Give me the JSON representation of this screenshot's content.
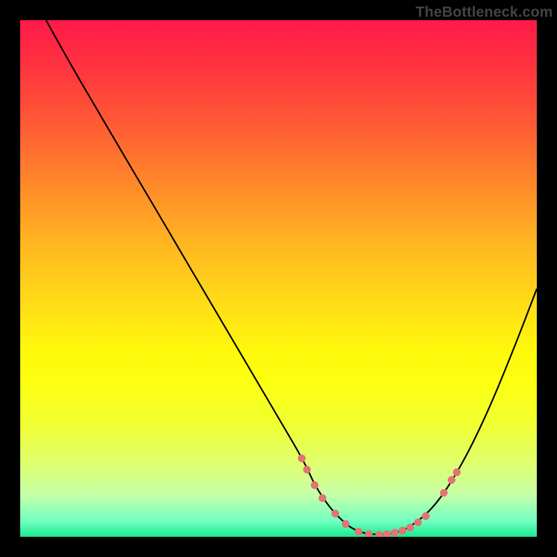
{
  "watermark": "TheBottleneck.com",
  "chart_data": {
    "type": "line",
    "title": "",
    "xlabel": "",
    "ylabel": "",
    "xlim": [
      0,
      100
    ],
    "ylim": [
      0,
      100
    ],
    "grid": false,
    "legend": false,
    "series": [
      {
        "name": "bottleneck-curve",
        "color": "#000000",
        "x": [
          5,
          10,
          15,
          20,
          25,
          30,
          35,
          40,
          45,
          50,
          55,
          57,
          60,
          63,
          65,
          67,
          70,
          72,
          75,
          80,
          85,
          90,
          95,
          100
        ],
        "y": [
          100,
          91,
          82.5,
          74,
          65.5,
          57,
          48.5,
          40,
          31.5,
          23,
          14.5,
          10,
          5.5,
          2.5,
          1.2,
          0.6,
          0.4,
          0.6,
          1.5,
          5.5,
          13,
          23,
          35,
          48
        ]
      }
    ],
    "markers": {
      "name": "highlight-dots",
      "color": "#e57373",
      "radius": 5.5,
      "points": [
        {
          "x": 54.5,
          "y": 15.2
        },
        {
          "x": 55.5,
          "y": 13.0
        },
        {
          "x": 57.0,
          "y": 10.0
        },
        {
          "x": 58.5,
          "y": 7.5
        },
        {
          "x": 61.0,
          "y": 4.5
        },
        {
          "x": 63.0,
          "y": 2.5
        },
        {
          "x": 65.5,
          "y": 1.0
        },
        {
          "x": 67.5,
          "y": 0.5
        },
        {
          "x": 69.5,
          "y": 0.4
        },
        {
          "x": 71.0,
          "y": 0.5
        },
        {
          "x": 72.5,
          "y": 0.8
        },
        {
          "x": 74.0,
          "y": 1.2
        },
        {
          "x": 75.5,
          "y": 1.8
        },
        {
          "x": 77.0,
          "y": 2.8
        },
        {
          "x": 78.5,
          "y": 4.0
        },
        {
          "x": 82.0,
          "y": 8.5
        },
        {
          "x": 83.5,
          "y": 11.0
        },
        {
          "x": 84.5,
          "y": 12.5
        }
      ]
    }
  }
}
